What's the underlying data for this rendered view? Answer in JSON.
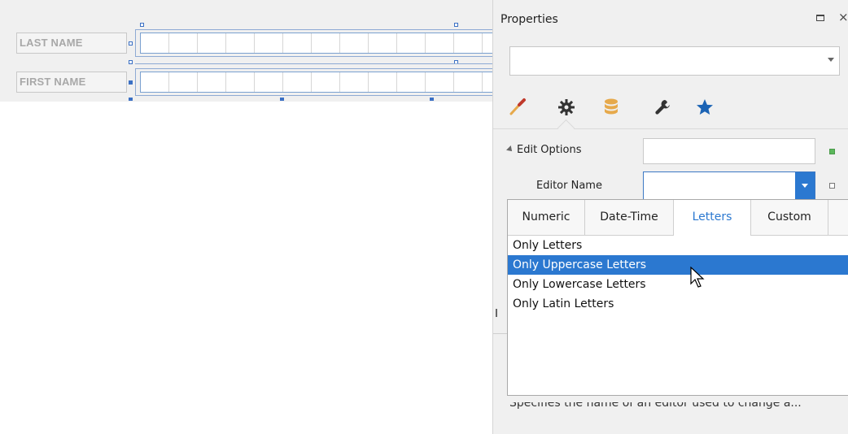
{
  "designer": {
    "rows": [
      {
        "label": "LAST NAME"
      },
      {
        "label": "FIRST NAME"
      }
    ]
  },
  "properties": {
    "title": "Properties",
    "restore_icon": "restore-window-icon",
    "close_icon": "close-icon",
    "close_glyph": "×",
    "object_selector_value": "",
    "tabs": [
      {
        "icon": "brush-icon",
        "color": "#c0392b"
      },
      {
        "icon": "gear-icon",
        "color": "#333333"
      },
      {
        "icon": "database-icon",
        "color": "#e6a94b"
      },
      {
        "icon": "wrench-icon",
        "color": "#333333"
      },
      {
        "icon": "star-icon",
        "color": "#1c64b5"
      }
    ],
    "group": {
      "label": "Edit Options",
      "value": ""
    },
    "editor_name": {
      "label": "Editor Name",
      "value": ""
    },
    "dropdown": {
      "tabs": [
        "Numeric",
        "Date-Time",
        "Letters",
        "Custom"
      ],
      "active_tab": "Letters",
      "items": [
        "Only Letters",
        "Only Uppercase Letters",
        "Only Lowercase Letters",
        "Only Latin Letters"
      ],
      "selected_item": "Only Uppercase Letters"
    },
    "description": "Specifies the name of an editor used to change a..."
  },
  "colors": {
    "accent": "#2b78d0",
    "panel_bg": "#f0f0f0"
  }
}
